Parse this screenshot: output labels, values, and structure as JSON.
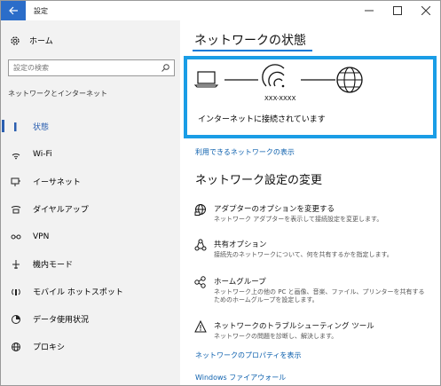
{
  "window": {
    "title": "設定"
  },
  "sidebar": {
    "home_label": "ホーム",
    "search_placeholder": "設定の検索",
    "section_label": "ネットワークとインターネット",
    "items": [
      {
        "label": "状態",
        "icon": "status-icon",
        "active": true
      },
      {
        "label": "Wi-Fi",
        "icon": "wifi-icon"
      },
      {
        "label": "イーサネット",
        "icon": "ethernet-icon"
      },
      {
        "label": "ダイヤルアップ",
        "icon": "dialup-icon"
      },
      {
        "label": "VPN",
        "icon": "vpn-icon"
      },
      {
        "label": "機内モード",
        "icon": "airplane-icon"
      },
      {
        "label": "モバイル ホットスポット",
        "icon": "hotspot-icon"
      },
      {
        "label": "データ使用状況",
        "icon": "data-usage-icon"
      },
      {
        "label": "プロキシ",
        "icon": "proxy-icon"
      }
    ]
  },
  "main": {
    "status_heading": "ネットワークの状態",
    "network_name": "XXX-XXXX",
    "connected_text": "インターネットに接続されています",
    "available_networks_link": "利用できるネットワークの表示",
    "settings_heading": "ネットワーク設定の変更",
    "options": [
      {
        "title": "アダプターのオプションを変更する",
        "desc": "ネットワーク アダプターを表示して接続設定を変更します。",
        "icon": "adapter-icon"
      },
      {
        "title": "共有オプション",
        "desc": "接続先のネットワークについて、何を共有するかを指定します。",
        "icon": "sharing-icon"
      },
      {
        "title": "ホームグループ",
        "desc": "ネットワーク上の他の PC と画像、音楽、ファイル、プリンターを共有するためのホームグループを設定します。",
        "icon": "homegroup-icon"
      },
      {
        "title": "ネットワークのトラブルシューティング ツール",
        "desc": "ネットワークの問題を診断し、解決します。",
        "icon": "troubleshoot-icon"
      }
    ],
    "properties_link": "ネットワークのプロパティを表示",
    "firewall_link": "Windows ファイアウォール"
  },
  "colors": {
    "accent": "#1a9de6",
    "link": "#0b5fad",
    "back_button": "#2b6dc9",
    "sidebar_bg": "#f2f2f2"
  }
}
